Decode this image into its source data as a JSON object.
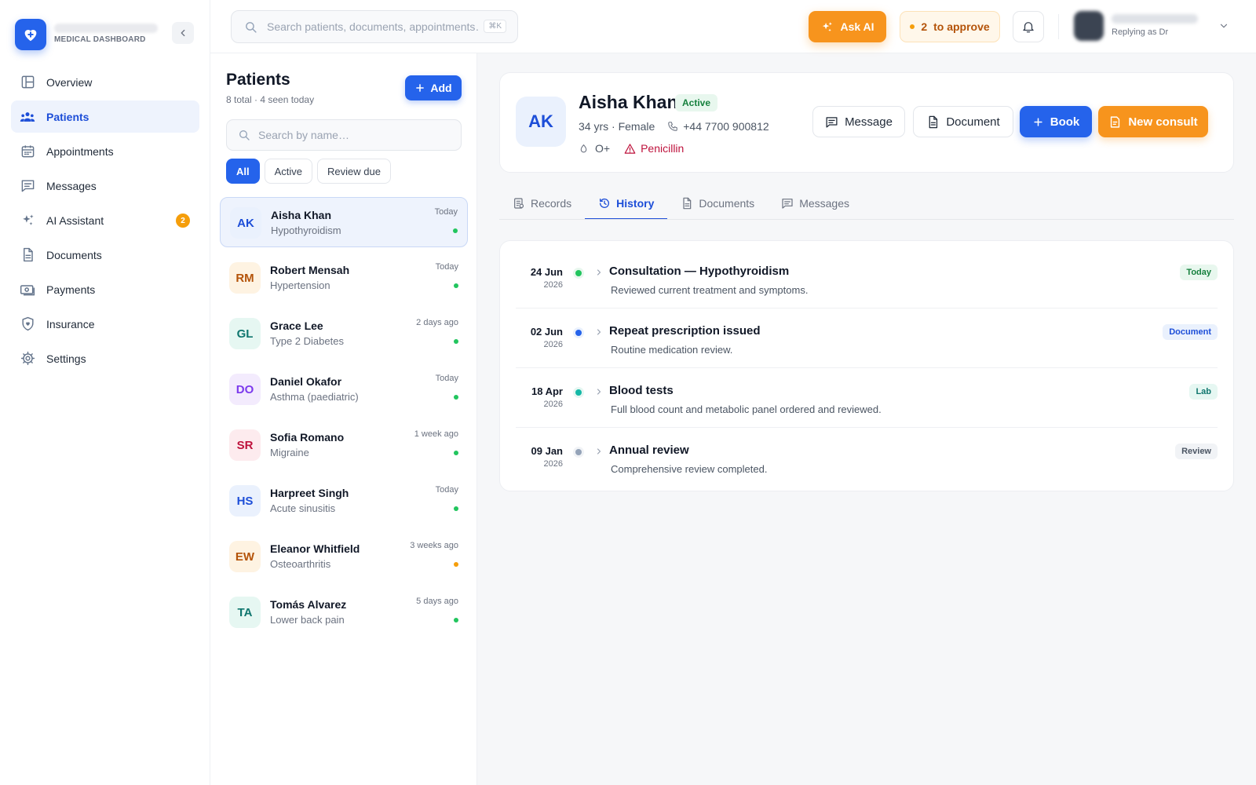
{
  "sidebar": {
    "brand_subtitle": "MEDICAL DASHBOARD",
    "items": [
      {
        "label": "Overview",
        "icon": "layout-icon"
      },
      {
        "label": "Patients",
        "icon": "users-icon",
        "active": true
      },
      {
        "label": "Appointments",
        "icon": "calendar-icon"
      },
      {
        "label": "Messages",
        "icon": "message-icon"
      },
      {
        "label": "AI Assistant",
        "icon": "sparkle-icon",
        "badge": "2"
      },
      {
        "label": "Documents",
        "icon": "document-icon"
      },
      {
        "label": "Payments",
        "icon": "banknote-icon"
      },
      {
        "label": "Insurance",
        "icon": "shield-icon"
      },
      {
        "label": "Settings",
        "icon": "gear-icon"
      }
    ]
  },
  "topbar": {
    "search_placeholder": "Search patients, documents, appointments…",
    "search_shortcut": "⌘K",
    "ask_ai": "Ask AI",
    "approve_count": "2",
    "approve_label": "to approve",
    "replying_as": "Replying as Dr"
  },
  "patients": {
    "title": "Patients",
    "subtitle": "8 total · 4 seen today",
    "add_label": "Add",
    "search_placeholder": "Search by name…",
    "filters": [
      "All",
      "Active",
      "Review due"
    ],
    "list": [
      {
        "initials": "AK",
        "name": "Aisha Khan",
        "condition": "Hypothyroidism",
        "time": "Today",
        "status_color": "#22c55e",
        "avatar_bg": "#eaf1fd",
        "avatar_fg": "#1d4ed8"
      },
      {
        "initials": "RM",
        "name": "Robert Mensah",
        "condition": "Hypertension",
        "time": "Today",
        "status_color": "#22c55e",
        "avatar_bg": "#fef3e2",
        "avatar_fg": "#b45309"
      },
      {
        "initials": "GL",
        "name": "Grace Lee",
        "condition": "Type 2 Diabetes",
        "time": "2 days ago",
        "status_color": "#22c55e",
        "avatar_bg": "#e6f7f2",
        "avatar_fg": "#0f766e"
      },
      {
        "initials": "DO",
        "name": "Daniel Okafor",
        "condition": "Asthma (paediatric)",
        "time": "Today",
        "status_color": "#22c55e",
        "avatar_bg": "#f3ebfd",
        "avatar_fg": "#7c3aed"
      },
      {
        "initials": "SR",
        "name": "Sofia Romano",
        "condition": "Migraine",
        "time": "1 week ago",
        "status_color": "#22c55e",
        "avatar_bg": "#fdebee",
        "avatar_fg": "#be123c"
      },
      {
        "initials": "HS",
        "name": "Harpreet Singh",
        "condition": "Acute sinusitis",
        "time": "Today",
        "status_color": "#22c55e",
        "avatar_bg": "#eaf1fd",
        "avatar_fg": "#1d4ed8"
      },
      {
        "initials": "EW",
        "name": "Eleanor Whitfield",
        "condition": "Osteoarthritis",
        "time": "3 weeks ago",
        "status_color": "#f59e0b",
        "avatar_bg": "#fef3e2",
        "avatar_fg": "#b45309"
      },
      {
        "initials": "TA",
        "name": "Tomás Alvarez",
        "condition": "Lower back pain",
        "time": "5 days ago",
        "status_color": "#22c55e",
        "avatar_bg": "#e6f7f2",
        "avatar_fg": "#0f766e"
      }
    ]
  },
  "detail": {
    "initials": "AK",
    "name": "Aisha Khan",
    "status": "Active",
    "age_sex": "34 yrs · Female",
    "phone": "+44 7700 900812",
    "blood": "O+",
    "allergy": "Penicillin",
    "buttons": {
      "message": "Message",
      "document": "Document",
      "book": "Book",
      "consult": "New consult"
    },
    "tabs": [
      {
        "label": "Records",
        "icon": "records-icon"
      },
      {
        "label": "History",
        "icon": "history-icon",
        "active": true
      },
      {
        "label": "Documents",
        "icon": "document-icon"
      },
      {
        "label": "Messages",
        "icon": "message-icon"
      }
    ],
    "history": [
      {
        "day": "24 Jun",
        "year": "2026",
        "title": "Consultation — Hypothyroidism",
        "desc": "Reviewed current treatment and symptoms.",
        "tag": "Today",
        "dot": "#22c55e",
        "tag_bg": "#e8f7ee",
        "tag_fg": "#15803d"
      },
      {
        "day": "02 Jun",
        "year": "2026",
        "title": "Repeat prescription issued",
        "desc": "Routine medication review.",
        "tag": "Document",
        "dot": "#2563eb",
        "tag_bg": "#eaf1fd",
        "tag_fg": "#1d4ed8"
      },
      {
        "day": "18 Apr",
        "year": "2026",
        "title": "Blood tests",
        "desc": "Full blood count and metabolic panel ordered and reviewed.",
        "tag": "Lab",
        "dot": "#14b8a6",
        "tag_bg": "#e6f7f2",
        "tag_fg": "#0f766e"
      },
      {
        "day": "09 Jan",
        "year": "2026",
        "title": "Annual review",
        "desc": "Comprehensive review completed.",
        "tag": "Review",
        "dot": "#94a3b8",
        "tag_bg": "#f1f3f6",
        "tag_fg": "#4b5563"
      }
    ]
  },
  "colors": {
    "primary": "#2563eb",
    "accent": "#f7941d",
    "success": "#22c55e",
    "danger": "#be123c"
  }
}
